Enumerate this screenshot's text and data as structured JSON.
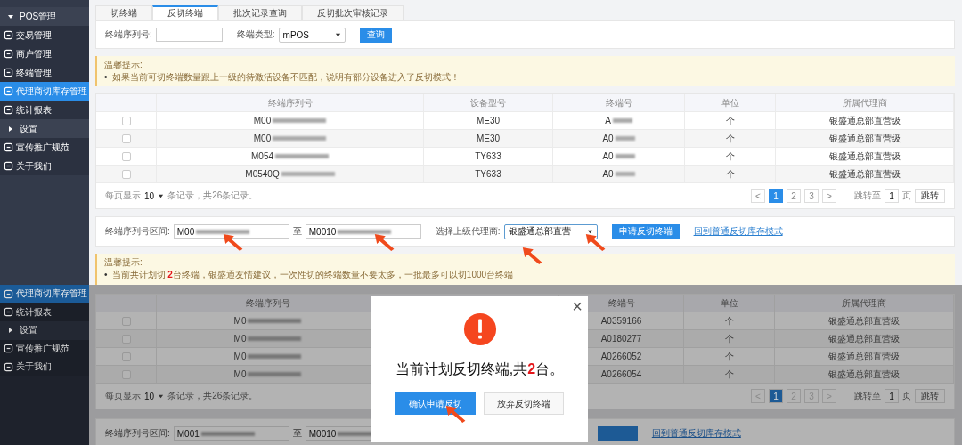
{
  "top": {
    "sidebar": [
      {
        "kind": "group",
        "label": "POS管理",
        "expanded": true,
        "selected": false
      },
      {
        "kind": "link",
        "label": "交易管理",
        "selected": false
      },
      {
        "kind": "link",
        "label": "商户管理",
        "selected": false
      },
      {
        "kind": "link",
        "label": "终端管理",
        "selected": false
      },
      {
        "kind": "link",
        "label": "代理商切库存管理",
        "selected": true
      },
      {
        "kind": "link",
        "label": "统计报表",
        "selected": false
      },
      {
        "kind": "group",
        "label": "设置",
        "expanded": false,
        "selected": false
      },
      {
        "kind": "link",
        "label": "宣传推广规范",
        "selected": false
      },
      {
        "kind": "link",
        "label": "关于我们",
        "selected": false
      }
    ],
    "tabs": [
      {
        "label": "切终端",
        "selected": false
      },
      {
        "label": "反切终端",
        "selected": true
      },
      {
        "label": "批次记录查询",
        "selected": false
      },
      {
        "label": "反切批次审核记录",
        "selected": false
      }
    ],
    "filter": {
      "serial_label": "终端序列号:",
      "type_label": "终端类型:",
      "type_value": "mPOS",
      "query_button": "查询"
    },
    "notice": {
      "title": "温馨提示:",
      "bullet": "•",
      "text": "如果当前可切终端数量跟上一级的待激活设备不匹配，说明有部分设备进入了反切模式！"
    },
    "table": {
      "columns": [
        "终端序列号",
        "设备型号",
        "终端号",
        "单位",
        "所属代理商"
      ],
      "rows": [
        {
          "checked": false,
          "serial": "M00",
          "model": "ME30",
          "terminal": "A",
          "unit": "个",
          "agent": "银盛通总部直营级"
        },
        {
          "checked": false,
          "serial": "M00",
          "model": "ME30",
          "terminal": "A0",
          "unit": "个",
          "agent": "银盛通总部直营级"
        },
        {
          "checked": false,
          "serial": "M054",
          "model": "TY633",
          "terminal": "A0",
          "unit": "个",
          "agent": "银盛通总部直营级"
        },
        {
          "checked": false,
          "serial": "M0540Q",
          "model": "TY633",
          "terminal": "A0",
          "unit": "个",
          "agent": "银盛通总部直营级"
        }
      ]
    },
    "pagination": {
      "per_page_label": "每页显示",
      "per_page": "10",
      "summary": "条记录，共26条记录。",
      "prev": "<",
      "pages": [
        {
          "label": "1",
          "selected": true
        },
        {
          "label": "2",
          "selected": false
        },
        {
          "label": "3",
          "selected": false
        }
      ],
      "next": ">",
      "jump_label": "跳转至",
      "jump_value": "1",
      "page_unit": "页",
      "jump_button": "跳转"
    },
    "range": {
      "label": "终端序列号区间:",
      "from": "M00",
      "to_label": "至",
      "to": "M0010",
      "agent_label": "选择上级代理商:",
      "agent_value": "银盛通总部直营",
      "apply_button": "申请反切终端",
      "back_link": "回到普通反切库存模式"
    },
    "notice2": {
      "title": "温馨提示:",
      "bullet": "•",
      "text": "当前共计划切 **2**台终端，银盛通友情建议，一次性切的终端数量不要太多，一批最多可以切1000台终端"
    }
  },
  "bottom": {
    "sidebar": [
      {
        "kind": "link",
        "label": "代理商切库存管理",
        "selected": true
      },
      {
        "kind": "link",
        "label": "统计报表",
        "selected": false
      },
      {
        "kind": "group",
        "label": "设置",
        "expanded": false,
        "selected": false
      },
      {
        "kind": "link",
        "label": "宣传推广规范",
        "selected": false
      },
      {
        "kind": "link",
        "label": "关于我们",
        "selected": false
      }
    ],
    "table": {
      "columns": [
        "终端序列号",
        "终端号",
        "单位",
        "所属代理商"
      ],
      "rows": [
        {
          "checked": false,
          "serial": "M0",
          "terminal": "A0359166",
          "unit": "个",
          "agent": "银盛通总部直营级"
        },
        {
          "checked": false,
          "serial": "M0",
          "terminal": "A0180277",
          "unit": "个",
          "agent": "银盛通总部直营级"
        },
        {
          "checked": false,
          "serial": "M0",
          "terminal": "A0266052",
          "unit": "个",
          "agent": "银盛通总部直营级"
        },
        {
          "checked": false,
          "serial": "M0",
          "terminal": "A0266054",
          "unit": "个",
          "agent": "银盛通总部直营级"
        }
      ]
    },
    "pagination": {
      "per_page_label": "每页显示",
      "per_page": "10",
      "summary": "条记录，共26条记录。",
      "prev": "<",
      "pages": [
        {
          "label": "1",
          "selected": true
        },
        {
          "label": "2",
          "selected": false
        },
        {
          "label": "3",
          "selected": false
        }
      ],
      "next": ">",
      "jump_label": "跳转至",
      "jump_value": "1",
      "page_unit": "页",
      "jump_button": "跳转"
    },
    "range": {
      "label": "终端序列号区间:",
      "from": "M001",
      "to_label": "至",
      "to": "M0010",
      "back_link": "回到普通反切库存模式"
    },
    "modal": {
      "close": "×",
      "title": "当前计划反切终端,共**2**台。",
      "confirm_button": "确认申请反切",
      "cancel_button": "放弃反切终端"
    }
  }
}
